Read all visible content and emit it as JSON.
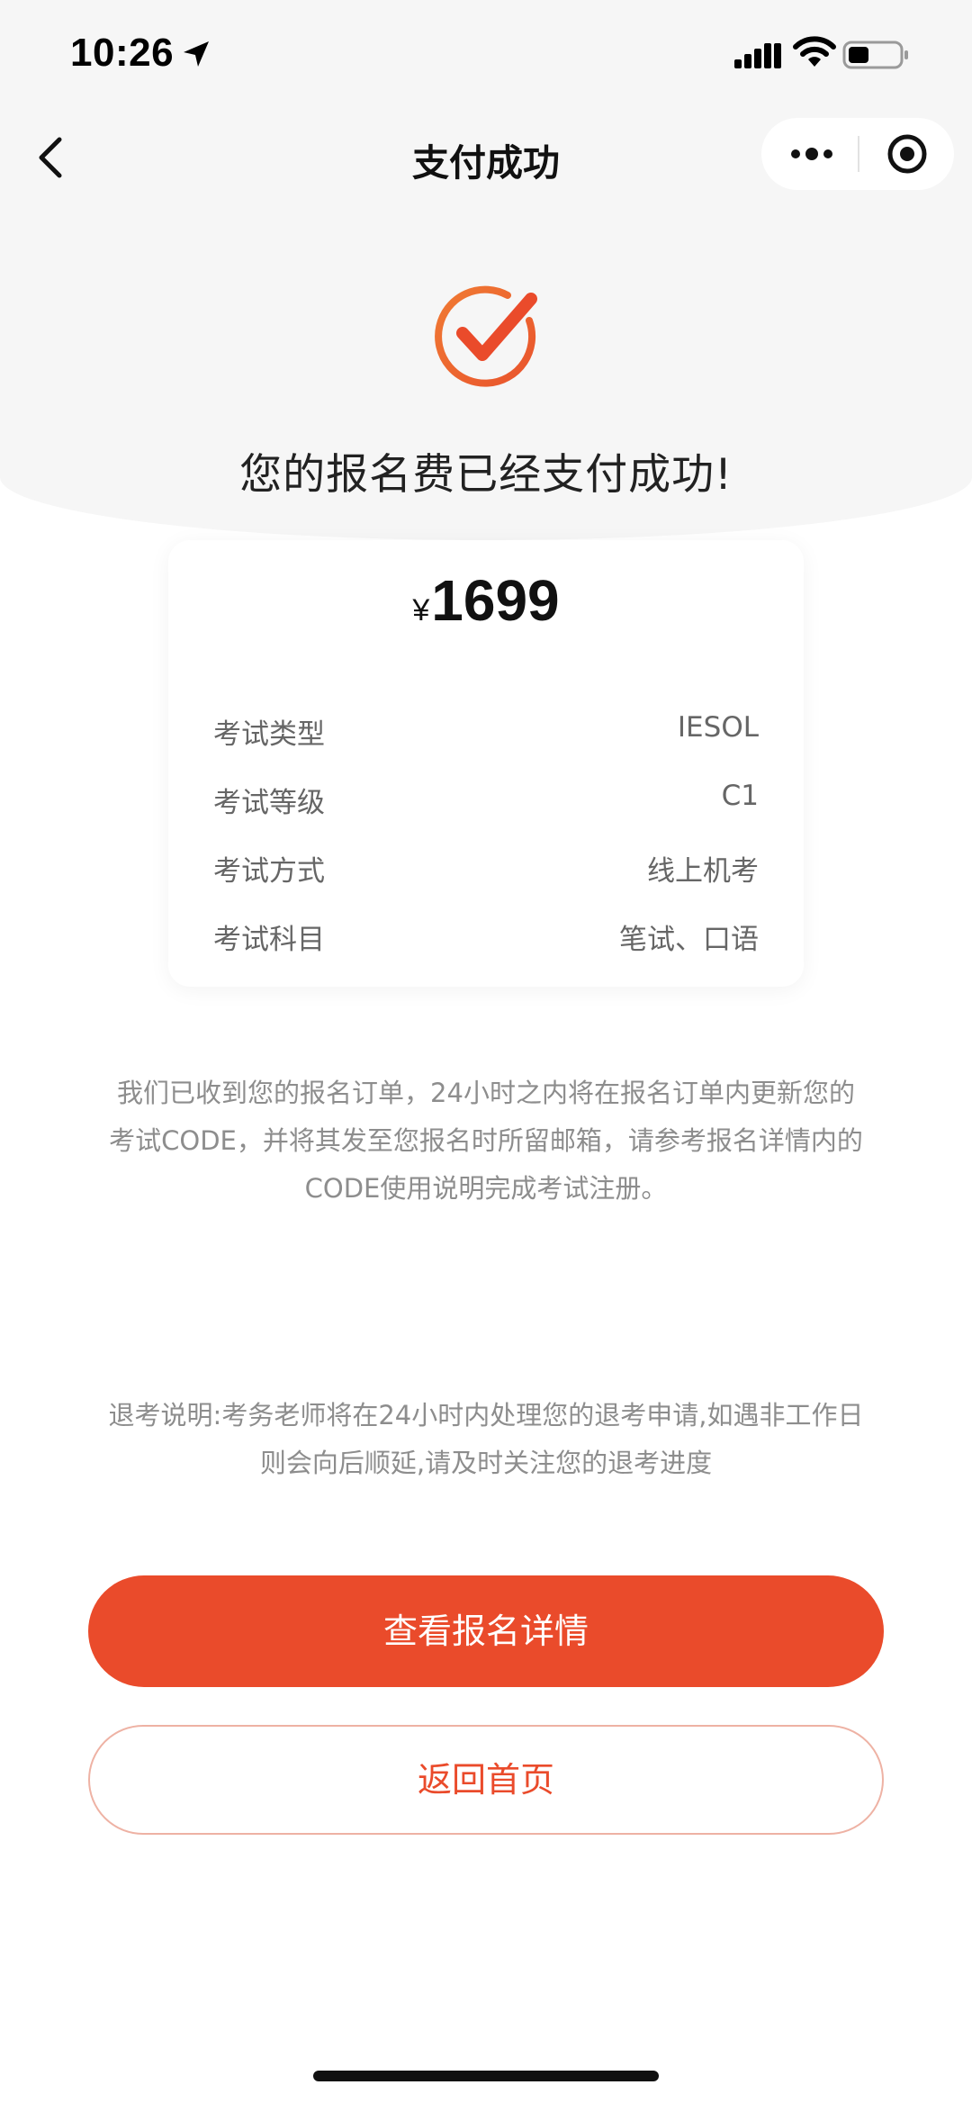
{
  "status_bar": {
    "time": "10:26",
    "icons": [
      "location-arrow-icon",
      "cellular-signal-icon",
      "wifi-icon",
      "battery-icon"
    ]
  },
  "nav": {
    "title": "支付成功",
    "icons": [
      "chevron-left-icon",
      "more-dots-icon",
      "mini-program-close-icon"
    ]
  },
  "result": {
    "icon": "success-check-icon",
    "message": "您的报名费已经支付成功!",
    "accent_color": "#ea4b2b"
  },
  "amount": {
    "currency": "¥",
    "value": "1699"
  },
  "details": [
    {
      "label": "考试类型",
      "value": "IESOL"
    },
    {
      "label": "考试等级",
      "value": "C1"
    },
    {
      "label": "考试方式",
      "value": "线上机考"
    },
    {
      "label": "考试科目",
      "value": "笔试、口语"
    }
  ],
  "notice": {
    "line1": "我们已收到您的报名订单，24小时之内将在报名订单内更新您的",
    "line2": "考试CODE，并将其发至您报名时所留邮箱，请参考报名详情内的",
    "line3": "CODE使用说明完成考试注册。"
  },
  "refund": {
    "line1": "退考说明:考务老师将在24小时内处理您的退考申请,如遇非工作日",
    "line2": "则会向后顺延,请及时关注您的退考进度"
  },
  "buttons": {
    "view_details": "查看报名详情",
    "back_home": "返回首页"
  }
}
